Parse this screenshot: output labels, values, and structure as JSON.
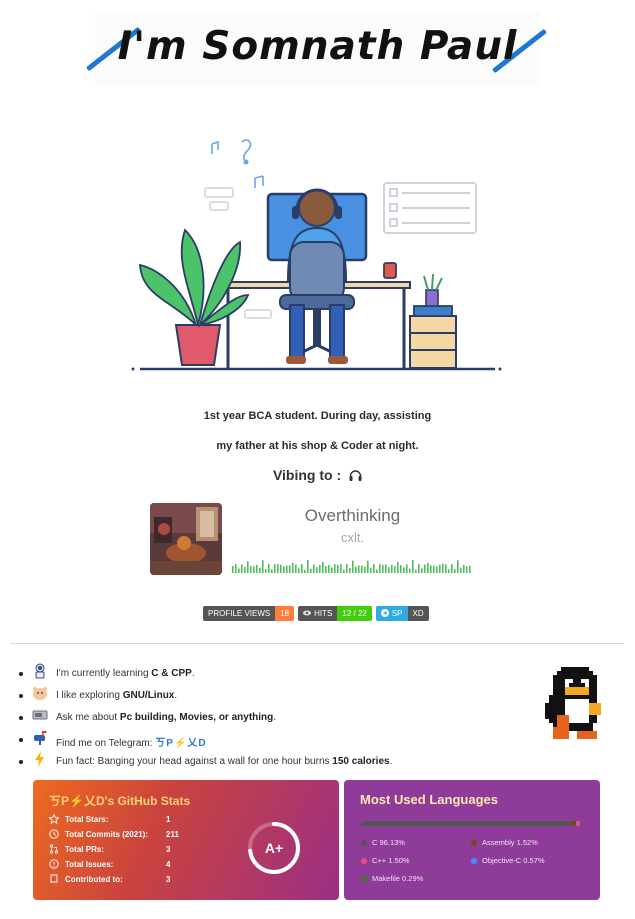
{
  "header": {
    "title": "I'm Somnath Paul"
  },
  "bio": {
    "line1": "1st year BCA student. During day, assisting",
    "line2": "my father at his shop & Coder at night."
  },
  "vibing": {
    "label": "Vibing to :"
  },
  "now_playing": {
    "song": "Overthinking",
    "artist": "cxlt."
  },
  "badges": [
    {
      "key": "PROFILE VIEWS",
      "value": "18"
    },
    {
      "key": "HITS",
      "value": "12 / 22"
    },
    {
      "key": "SP",
      "value": "XD"
    }
  ],
  "about": {
    "items": [
      {
        "pre": "I'm currently learning ",
        "bold": "C & CPP",
        "post": ".",
        "icon": "astronaut-icon"
      },
      {
        "pre": "I like exploring ",
        "bold": "GNU/Linux",
        "post": ".",
        "icon": "hamster-icon"
      },
      {
        "pre": "Ask me about ",
        "bold": "Pc building, Movies, or anything",
        "post": ".",
        "icon": "computer-icon"
      },
      {
        "pre": "Find me on Telegram: ",
        "tg": "ㄎP⚡乂D",
        "post": "",
        "icon": "mailbox-icon"
      },
      {
        "pre": "Fun fact: Banging your head against a wall for one hour burns ",
        "bold": "150 calories",
        "post": ".",
        "icon": "lightning-icon"
      }
    ]
  },
  "github_stats": {
    "title": "ㄎP⚡乂D's GitHub Stats",
    "rows": [
      {
        "label": "Total Stars:",
        "value": "1",
        "icon": "star-icon"
      },
      {
        "label": "Total Commits (2021):",
        "value": "211",
        "icon": "clock-icon"
      },
      {
        "label": "Total PRs:",
        "value": "3",
        "icon": "pull-request-icon"
      },
      {
        "label": "Total Issues:",
        "value": "4",
        "icon": "issue-icon"
      },
      {
        "label": "Contributed to:",
        "value": "3",
        "icon": "repo-icon"
      }
    ],
    "rank": "A+",
    "colors": {
      "gradient_start": "#ee6a1f",
      "gradient_end": "#9b2f86",
      "title": "#ffd27a"
    }
  },
  "languages": {
    "title": "Most Used Languages",
    "items": [
      {
        "name": "C",
        "percent": "96.13%",
        "value": 96.13,
        "color": "#555555"
      },
      {
        "name": "Assembly",
        "percent": "1.52%",
        "value": 1.52,
        "color": "#6E4C13"
      },
      {
        "name": "C++",
        "percent": "1.50%",
        "value": 1.5,
        "color": "#f34b7d"
      },
      {
        "name": "Objective-C",
        "percent": "0.57%",
        "value": 0.57,
        "color": "#438eff"
      },
      {
        "name": "Makefile",
        "percent": "0.29%",
        "value": 0.29,
        "color": "#427819"
      }
    ]
  }
}
